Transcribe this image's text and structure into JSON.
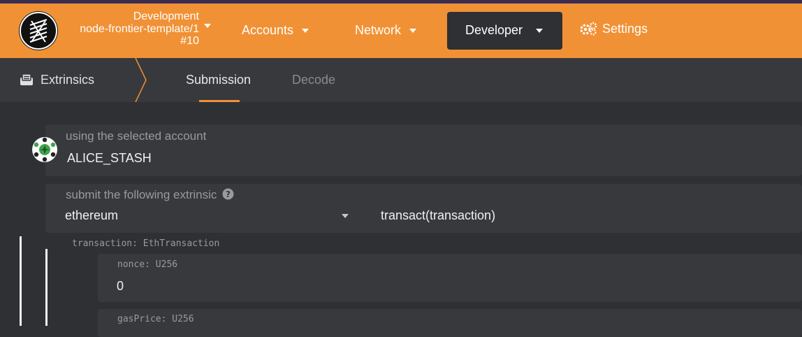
{
  "header": {
    "chain_name": "Development",
    "runtime": "node-frontier-template/1",
    "block": "#10",
    "nav": {
      "accounts": "Accounts",
      "network": "Network",
      "developer": "Developer",
      "settings": "Settings"
    }
  },
  "subnav": {
    "title": "Extrinsics",
    "tabs": [
      "Submission",
      "Decode"
    ],
    "active_tab": "Submission"
  },
  "account": {
    "label": "using the selected account",
    "name": "ALICE_STASH"
  },
  "extrinsic": {
    "label": "submit the following extrinsic",
    "section": "ethereum",
    "method": "transact(transaction)"
  },
  "params": {
    "transaction_label": "transaction: EthTransaction",
    "nonce_label": "nonce: U256",
    "nonce_value": "0",
    "gasprice_label": "gasPrice: U256"
  },
  "colors": {
    "accent": "#f19135",
    "background": "#2f3034",
    "panel": "#38393d"
  }
}
